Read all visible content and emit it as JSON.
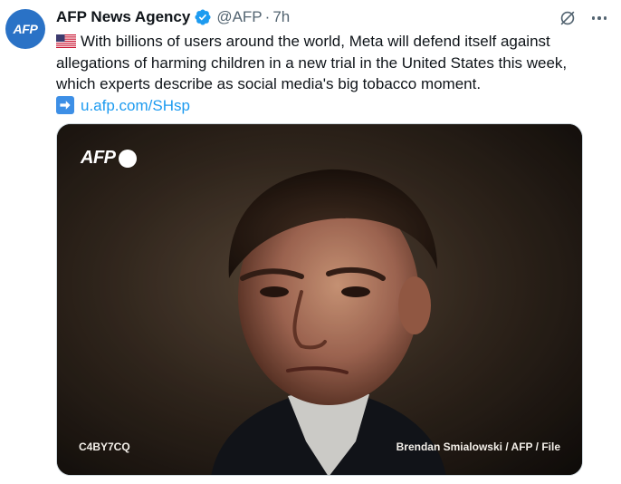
{
  "account": {
    "avatar_text": "AFP",
    "name": "AFP News Agency",
    "handle": "@AFP",
    "separator": "·",
    "time": "7h",
    "verified_color": "#1d9bf0"
  },
  "post": {
    "text": "With billions of users around the world, Meta will defend itself against allegations of harming children in a new trial in the United States this week, which experts describe as social media's big tobacco moment.",
    "link": "u.afp.com/SHsp"
  },
  "media": {
    "logo_text": "AFP",
    "code": "C4BY7CQ",
    "credit": "Brendan Smialowski / AFP / File"
  },
  "icons": {
    "verified": "verified-badge-icon",
    "grok": "grok-icon",
    "more": "more-icon",
    "flag": "us-flag-icon",
    "arrow": "right-arrow-icon"
  },
  "colors": {
    "text": "#0f1419",
    "secondary": "#536471",
    "link": "#1d9bf0",
    "avatar": "#2a72c6"
  }
}
